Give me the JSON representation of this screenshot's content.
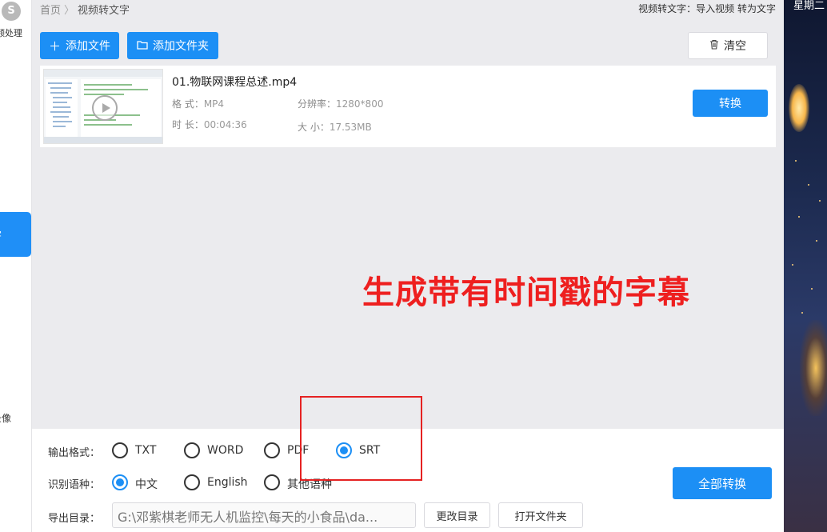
{
  "sidebar": {
    "logo_glyph": "S",
    "item_top_label": "音频处理",
    "item_active_label": "字",
    "item_bottom_label": "录像"
  },
  "breadcrumb": {
    "home": "首页",
    "separator": "〉",
    "current": "视频转文字"
  },
  "header_right": {
    "text": "视频转文字：导入视频 转为文字"
  },
  "toolbar": {
    "add_file_label": "添加文件",
    "add_folder_label": "添加文件夹",
    "clear_label": "清空"
  },
  "file": {
    "name": "01.物联网课程总述.mp4",
    "format_label": "格  式：",
    "format_value": "MP4",
    "resolution_label": "分辨率：",
    "resolution_value": "1280*800",
    "duration_label": "时  长：",
    "duration_value": "00:04:36",
    "size_label": "大  小：",
    "size_value": "17.53MB",
    "convert_label": "转换"
  },
  "annotation": {
    "caption": "生成带有时间戳的字幕",
    "color": "#ee1f1f"
  },
  "output": {
    "format_label": "输出格式：",
    "formats": [
      "TXT",
      "WORD",
      "PDF",
      "SRT"
    ],
    "selected_format": "SRT",
    "language_label": "识别语种：",
    "languages": [
      "中文",
      "English",
      "其他语种"
    ],
    "selected_language": "中文",
    "dir_label": "导出目录：",
    "dir_value": "G:\\邓紫棋老师无人机监控\\每天的小食品\\da...",
    "change_dir_label": "更改目录",
    "open_folder_label": "打开文件夹",
    "convert_all_label": "全部转换"
  },
  "wallpaper": {
    "corner_text": "星期二"
  },
  "colors": {
    "accent": "#1c8ff5",
    "annotation_red": "#ee1f1f"
  },
  "icons": {
    "plus": "plus-icon",
    "folder": "folder-icon",
    "trash": "trash-icon",
    "play": "play-icon"
  }
}
